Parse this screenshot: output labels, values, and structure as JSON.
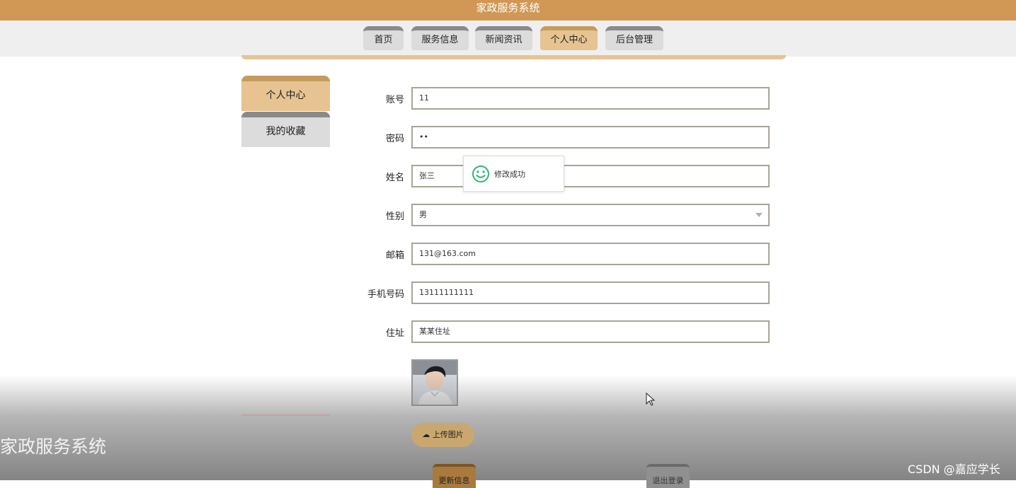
{
  "app": {
    "title": "家政服务系统"
  },
  "nav": {
    "items": [
      {
        "label": "首页"
      },
      {
        "label": "服务信息"
      },
      {
        "label": "新闻资讯"
      },
      {
        "label": "个人中心",
        "active": true
      },
      {
        "label": "后台管理"
      }
    ]
  },
  "sidebar": {
    "items": [
      {
        "label": "个人中心",
        "active": true
      },
      {
        "label": "我的收藏"
      }
    ]
  },
  "form": {
    "account": {
      "label": "账号",
      "value": "11"
    },
    "password": {
      "label": "密码",
      "value": "••"
    },
    "name": {
      "label": "姓名",
      "value": "张三"
    },
    "gender": {
      "label": "性别",
      "value": "男"
    },
    "email": {
      "label": "邮箱",
      "value": "131@163.com"
    },
    "phone": {
      "label": "手机号码",
      "value": "13111111111"
    },
    "address": {
      "label": "住址",
      "value": "某某住址"
    },
    "upload_label": "上传图片"
  },
  "toast": {
    "text": "修改成功"
  },
  "bottom_buttons": {
    "update": "更新信息",
    "logout": "退出登录"
  },
  "footer": {
    "title": "家政服务系统"
  },
  "watermark": "CSDN @嘉应学长",
  "colors": {
    "brand": "#d09755",
    "active_tab": "#e6c391",
    "inactive_tab": "#dcdcdc",
    "success": "#2fb47a"
  }
}
